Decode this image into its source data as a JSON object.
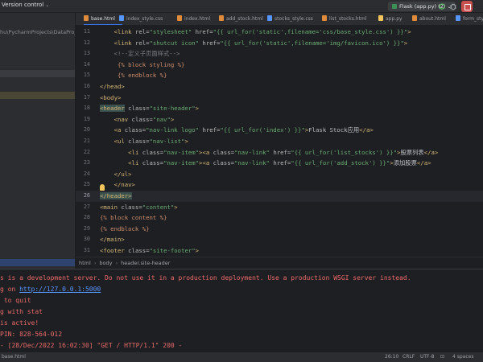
{
  "topbar": {
    "vcs_label": "Version control",
    "run_config": "Flask (app.py) (2)"
  },
  "project": {
    "path_fragment": "hu\\PycharmProjects\\DataProject"
  },
  "tabs": [
    {
      "label": "base.html",
      "active": true,
      "icon_color": "#e08c3c"
    },
    {
      "label": "index_style.css",
      "active": false,
      "icon_color": "#5896ff"
    },
    {
      "label": "index.html",
      "active": false,
      "icon_color": "#e08c3c"
    },
    {
      "label": "add_stock.html",
      "active": false,
      "icon_color": "#e08c3c"
    },
    {
      "label": "stocks_style.css",
      "active": false,
      "icon_color": "#5896ff"
    },
    {
      "label": "list_stocks.html",
      "active": false,
      "icon_color": "#e08c3c"
    },
    {
      "label": "app.py",
      "active": false,
      "icon_color": "#f2c55c"
    },
    {
      "label": "about.html",
      "active": false,
      "icon_color": "#e08c3c"
    },
    {
      "label": "form_style.",
      "active": false,
      "icon_color": "#5896ff"
    }
  ],
  "editor": {
    "current_line": 26,
    "lines": [
      {
        "n": "11",
        "parts": [
          [
            "    ",
            ""
          ],
          [
            "<link",
            "tag"
          ],
          [
            " rel=",
            "attr"
          ],
          [
            "\"stylesheet\"",
            "str"
          ],
          [
            " href=",
            "attr"
          ],
          [
            "\"{{ url_for('static',filename='css/base_style.css') }}\"",
            "str"
          ],
          [
            ">",
            "tag"
          ]
        ]
      },
      {
        "n": "12",
        "parts": [
          [
            "    ",
            ""
          ],
          [
            "<link",
            "tag"
          ],
          [
            " rel=",
            "attr"
          ],
          [
            "\"shutcut icon\"",
            "str"
          ],
          [
            " href=",
            "attr"
          ],
          [
            "\"{{ url_for('static',filename='img/favicon.ico') }}\"",
            "str"
          ],
          [
            ">",
            "tag"
          ]
        ]
      },
      {
        "n": "13",
        "parts": [
          [
            "    ",
            ""
          ],
          [
            "<!--定义子页面样式-->",
            "cm"
          ]
        ]
      },
      {
        "n": "14",
        "parts": [
          [
            "     ",
            ""
          ],
          [
            "{% block styling %}",
            "tpl"
          ]
        ]
      },
      {
        "n": "15",
        "parts": [
          [
            "     ",
            ""
          ],
          [
            "{% endblock %}",
            "tpl"
          ]
        ]
      },
      {
        "n": "16",
        "parts": [
          [
            "",
            ""
          ],
          [
            "</head>",
            "tag"
          ]
        ]
      },
      {
        "n": "17",
        "parts": [
          [
            "",
            ""
          ],
          [
            "<body>",
            "tag"
          ]
        ]
      },
      {
        "n": "18",
        "parts": [
          [
            "",
            ""
          ],
          [
            "<header",
            "tagsel"
          ],
          [
            " class=",
            "attr"
          ],
          [
            "\"site-header\"",
            "str"
          ],
          [
            ">",
            "tag"
          ]
        ]
      },
      {
        "n": "19",
        "parts": [
          [
            "    ",
            ""
          ],
          [
            "<nav",
            "tag"
          ],
          [
            " class=",
            "attr"
          ],
          [
            "\"nav\"",
            "str"
          ],
          [
            ">",
            "tag"
          ]
        ]
      },
      {
        "n": "20",
        "parts": [
          [
            "    ",
            ""
          ],
          [
            "<a",
            "tag"
          ],
          [
            " class=",
            "attr"
          ],
          [
            "\"nav-link logo\"",
            "str"
          ],
          [
            " href=",
            "attr"
          ],
          [
            "\"{{ url_for('index') }}\"",
            "str"
          ],
          [
            ">",
            "tag"
          ],
          [
            "Flask Stock应用",
            "cn"
          ],
          [
            "</a>",
            "tag"
          ]
        ]
      },
      {
        "n": "21",
        "parts": [
          [
            "    ",
            ""
          ],
          [
            "<ul",
            "tag"
          ],
          [
            " class=",
            "attr"
          ],
          [
            "\"nav-list\"",
            "str"
          ],
          [
            ">",
            "tag"
          ]
        ]
      },
      {
        "n": "22",
        "parts": [
          [
            "        ",
            ""
          ],
          [
            "<li",
            "tag"
          ],
          [
            " class=",
            "attr"
          ],
          [
            "\"nav-item\"",
            "str"
          ],
          [
            "><a",
            "tag"
          ],
          [
            " class=",
            "attr"
          ],
          [
            "\"nav-link\"",
            "str"
          ],
          [
            " href=",
            "attr"
          ],
          [
            "\"{{ url_for('list_stocks') }}\"",
            "str"
          ],
          [
            ">",
            "tag"
          ],
          [
            "股票列表",
            "cn"
          ],
          [
            "</a>",
            "tag"
          ]
        ]
      },
      {
        "n": "23",
        "parts": [
          [
            "        ",
            ""
          ],
          [
            "<li",
            "tag"
          ],
          [
            " class=",
            "attr"
          ],
          [
            "\"nav-item\"",
            "str"
          ],
          [
            "><a",
            "tag"
          ],
          [
            " class=",
            "attr"
          ],
          [
            "\"nav-link\"",
            "str"
          ],
          [
            " href=",
            "attr"
          ],
          [
            "\"{{ url_for('add_stock') }}\"",
            "str"
          ],
          [
            ">",
            "tag"
          ],
          [
            "添加股票",
            "cn"
          ],
          [
            "</a>",
            "tag"
          ]
        ]
      },
      {
        "n": "24",
        "parts": [
          [
            "    ",
            ""
          ],
          [
            "</ul>",
            "tag"
          ]
        ]
      },
      {
        "n": "25",
        "parts": [
          [
            "    ",
            ""
          ],
          [
            "</nav>",
            "tag"
          ]
        ]
      },
      {
        "n": "26",
        "parts": [
          [
            "",
            ""
          ],
          [
            "</header>",
            "tagsel"
          ]
        ]
      },
      {
        "n": "27",
        "parts": [
          [
            "",
            ""
          ],
          [
            "<main",
            "tag"
          ],
          [
            " class=",
            "attr"
          ],
          [
            "\"content\"",
            "str"
          ],
          [
            ">",
            "tag"
          ]
        ]
      },
      {
        "n": "28",
        "parts": [
          [
            "",
            ""
          ],
          [
            "{% block content %}",
            "tpl"
          ]
        ]
      },
      {
        "n": "29",
        "parts": [
          [
            "",
            ""
          ],
          [
            "{% endblock %}",
            "tpl"
          ]
        ]
      },
      {
        "n": "30",
        "parts": [
          [
            "",
            ""
          ],
          [
            "</main>",
            "tag"
          ]
        ]
      },
      {
        "n": "31",
        "parts": [
          [
            "",
            ""
          ],
          [
            "<footer",
            "tag"
          ],
          [
            " class=",
            "attr"
          ],
          [
            "\"site-footer\"",
            "str"
          ],
          [
            ">",
            "tag"
          ]
        ]
      }
    ]
  },
  "breadcrumb": [
    "html",
    "body",
    "header.site-header"
  ],
  "console": {
    "lines": [
      {
        "kind": "red",
        "text": "s is a development server. Do not use it in a production deployment. Use a production WSGI server instead."
      },
      {
        "kind": "link",
        "prefix": "g on ",
        "url": "http://127.0.0.1:5000"
      },
      {
        "kind": "red",
        "text": " to quit"
      },
      {
        "kind": "red",
        "text": "g with stat"
      },
      {
        "kind": "red",
        "text": "is active!"
      },
      {
        "kind": "red",
        "text": "PIN: 828-564-012"
      },
      {
        "kind": "red",
        "text": "- [28/Dec/2022 16:02:30] \"GET / HTTP/1.1\" 200 -"
      }
    ]
  },
  "statusbar": {
    "file": "base.html",
    "position": "26:10",
    "line_sep": "CRLF",
    "encoding": "UTF-8",
    "indent": "4 spaces"
  },
  "colors": {
    "accent": "#3574f0",
    "stop": "#c94f4f",
    "console_red": "#e86a6a"
  }
}
